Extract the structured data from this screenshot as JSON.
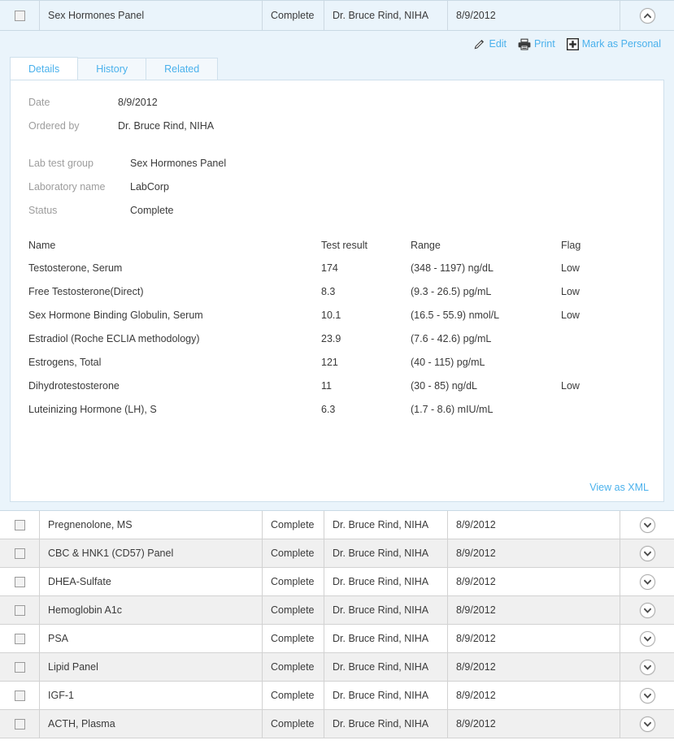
{
  "expanded_row": {
    "name": "Sex Hormones Panel",
    "status": "Complete",
    "doctor": "Dr. Bruce Rind, NIHA",
    "date": "8/9/2012",
    "toggle_icon": "chevron-up-icon"
  },
  "actions": [
    {
      "label": "Edit",
      "icon": "pencil-icon"
    },
    {
      "label": "Print",
      "icon": "printer-icon"
    },
    {
      "label": "Mark as Personal",
      "icon": "plus-box-icon"
    }
  ],
  "tabs": [
    {
      "label": "Details",
      "active": true
    },
    {
      "label": "History",
      "active": false
    },
    {
      "label": "Related",
      "active": false
    }
  ],
  "details": {
    "fields_top": [
      {
        "label": "Date",
        "value": "8/9/2012"
      },
      {
        "label": "Ordered by",
        "value": "Dr. Bruce Rind, NIHA"
      }
    ],
    "fields_bottom": [
      {
        "label": "Lab test group",
        "value": "Sex Hormones Panel"
      },
      {
        "label": "Laboratory name",
        "value": "LabCorp"
      },
      {
        "label": "Status",
        "value": "Complete"
      }
    ],
    "results_headers": [
      "Name",
      "Test result",
      "Range",
      "Flag"
    ],
    "results": [
      {
        "name": "Testosterone, Serum",
        "result": "174",
        "range": "(348 - 1197) ng/dL",
        "flag": "Low"
      },
      {
        "name": "Free Testosterone(Direct)",
        "result": "8.3",
        "range": "(9.3 - 26.5) pg/mL",
        "flag": "Low"
      },
      {
        "name": "Sex Hormone Binding Globulin, Serum",
        "result": "10.1",
        "range": "(16.5 - 55.9) nmol/L",
        "flag": "Low"
      },
      {
        "name": "Estradiol (Roche ECLIA methodology)",
        "result": "23.9",
        "range": "(7.6 - 42.6) pg/mL",
        "flag": ""
      },
      {
        "name": "Estrogens, Total",
        "result": "121",
        "range": "(40 - 115) pg/mL",
        "flag": ""
      },
      {
        "name": "Dihydrotestosterone",
        "result": "11",
        "range": "(30 - 85) ng/dL",
        "flag": "Low"
      },
      {
        "name": "Luteinizing Hormone (LH), S",
        "result": "6.3",
        "range": "(1.7 - 8.6) mIU/mL",
        "flag": ""
      }
    ],
    "xml_link": "View as XML"
  },
  "collapsed_rows": [
    {
      "name": "Pregnenolone, MS",
      "status": "Complete",
      "doctor": "Dr. Bruce Rind, NIHA",
      "date": "8/9/2012"
    },
    {
      "name": "CBC & HNK1 (CD57) Panel",
      "status": "Complete",
      "doctor": "Dr. Bruce Rind, NIHA",
      "date": "8/9/2012"
    },
    {
      "name": "DHEA-Sulfate",
      "status": "Complete",
      "doctor": "Dr. Bruce Rind, NIHA",
      "date": "8/9/2012"
    },
    {
      "name": "Hemoglobin A1c",
      "status": "Complete",
      "doctor": "Dr. Bruce Rind, NIHA",
      "date": "8/9/2012"
    },
    {
      "name": "PSA",
      "status": "Complete",
      "doctor": "Dr. Bruce Rind, NIHA",
      "date": "8/9/2012"
    },
    {
      "name": "Lipid Panel",
      "status": "Complete",
      "doctor": "Dr. Bruce Rind, NIHA",
      "date": "8/9/2012"
    },
    {
      "name": "IGF-1",
      "status": "Complete",
      "doctor": "Dr. Bruce Rind, NIHA",
      "date": "8/9/2012"
    },
    {
      "name": "ACTH, Plasma",
      "status": "Complete",
      "doctor": "Dr. Bruce Rind, NIHA",
      "date": "8/9/2012"
    }
  ],
  "colors": {
    "link": "#4ab1ec",
    "expanded_bg": "#eaf4fb",
    "alt_row_bg": "#f0f0f0",
    "text": "#3a3a3a",
    "label": "#9d9d9d"
  }
}
